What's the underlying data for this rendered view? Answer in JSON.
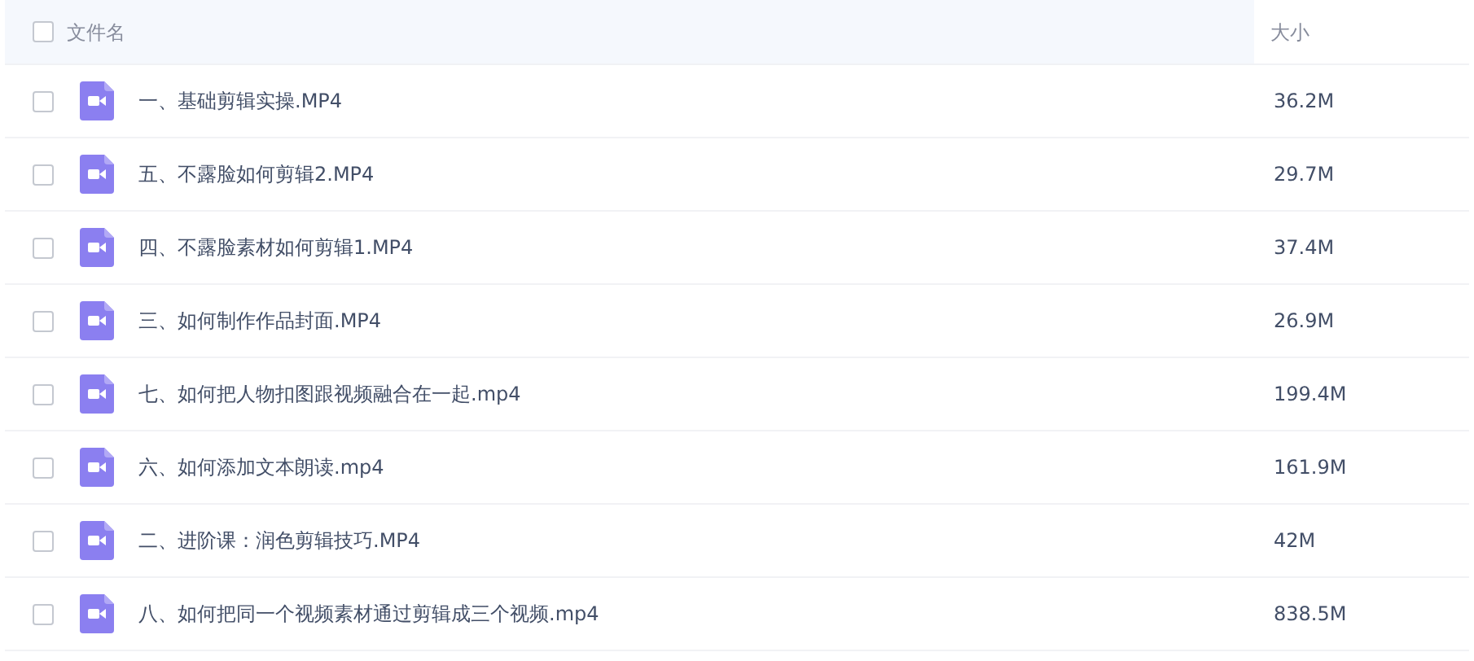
{
  "header": {
    "checkbox_checked": false,
    "name_column": "文件名",
    "size_column": "大小"
  },
  "files": [
    {
      "name": "一、基础剪辑实操.MP4",
      "size": "36.2M",
      "checked": false
    },
    {
      "name": "五、不露脸如何剪辑2.MP4",
      "size": "29.7M",
      "checked": false
    },
    {
      "name": "四、不露脸素材如何剪辑1.MP4",
      "size": "37.4M",
      "checked": false
    },
    {
      "name": "三、如何制作作品封面.MP4",
      "size": "26.9M",
      "checked": false
    },
    {
      "name": "七、如何把人物扣图跟视频融合在一起.mp4",
      "size": "199.4M",
      "checked": false
    },
    {
      "name": "六、如何添加文本朗读.mp4",
      "size": "161.9M",
      "checked": false
    },
    {
      "name": "二、进阶课：润色剪辑技巧.MP4",
      "size": "42M",
      "checked": false
    },
    {
      "name": "八、如何把同一个视频素材通过剪辑成三个视频.mp4",
      "size": "838.5M",
      "checked": false
    }
  ]
}
